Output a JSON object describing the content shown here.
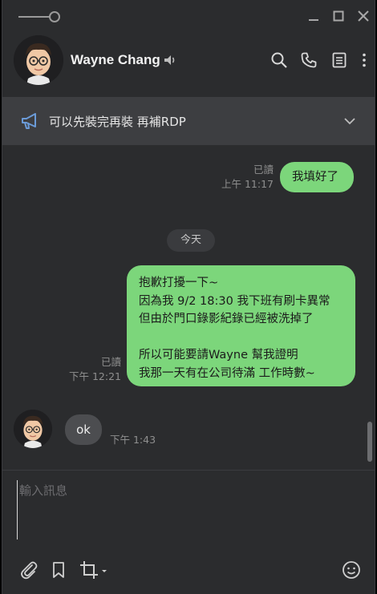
{
  "header": {
    "contact_name": "Wayne Chang"
  },
  "announcement": {
    "text": "可以先裝完再裝 再補RDP"
  },
  "messages": {
    "m1": {
      "lines": [
        "我填好了"
      ],
      "read": "已讀",
      "time": "上午 11:17"
    },
    "day_separator": "今天",
    "m2": {
      "lines": [
        "抱歉打擾一下~",
        "因為我 9/2 18:30 我下班有刷卡異常",
        "但由於門口錄影紀錄已經被洗掉了",
        "",
        "所以可能要請Wayne 幫我證明",
        "我那一天有在公司待滿 工作時數~"
      ],
      "read": "已讀",
      "time": "下午 12:21"
    },
    "m3": {
      "text": "ok",
      "time": "下午 1:43"
    }
  },
  "input": {
    "placeholder": "輸入訊息"
  },
  "colors": {
    "window_bg": "#2b2c2e",
    "outgoing_bubble": "#7cd67b",
    "incoming_bubble": "#4c4d50",
    "announcement_bg": "#3d3e41",
    "accent_icon": "#6b9bd8"
  },
  "icons": {
    "titlebar": [
      "pin-icon",
      "minimize-icon",
      "maximize-icon",
      "close-icon"
    ],
    "header": [
      "speaker-icon",
      "search-icon",
      "phone-icon",
      "notes-icon",
      "more-icon"
    ],
    "announcement": [
      "megaphone-icon",
      "chevron-down-icon"
    ],
    "toolbar": [
      "paperclip-icon",
      "bookmark-icon",
      "crop-icon",
      "emoji-icon"
    ]
  }
}
